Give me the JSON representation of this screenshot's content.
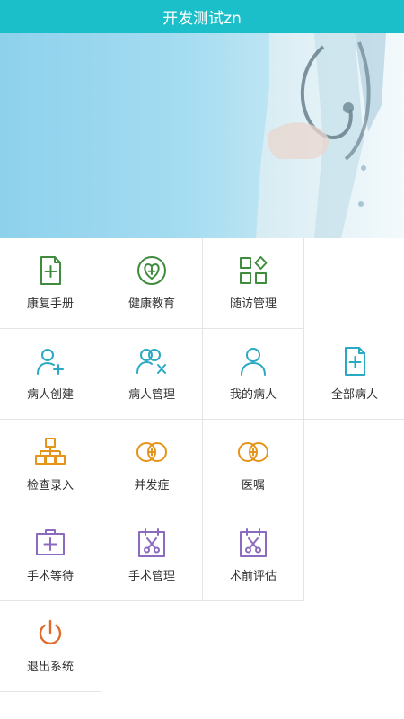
{
  "header": {
    "title": "开发测试zn"
  },
  "banner": {
    "image": "doctor-with-stethoscope"
  },
  "menu": [
    {
      "label": "康复手册",
      "icon": "rehab-manual-icon",
      "color": "#3f8c3e"
    },
    {
      "label": "健康教育",
      "icon": "health-education-icon",
      "color": "#3f8c3e"
    },
    {
      "label": "随访管理",
      "icon": "follow-up-icon",
      "color": "#3f8c3e"
    },
    {
      "label": "病人创建",
      "icon": "add-patient-icon",
      "color": "#2aa9c4"
    },
    {
      "label": "病人管理",
      "icon": "patient-management-icon",
      "color": "#2aa9c4"
    },
    {
      "label": "我的病人",
      "icon": "my-patient-icon",
      "color": "#2aa9c4"
    },
    {
      "label": "全部病人",
      "icon": "all-patients-icon",
      "color": "#2aa9c4"
    },
    {
      "label": "检查录入",
      "icon": "examination-entry-icon",
      "color": "#e5941a"
    },
    {
      "label": "并发症",
      "icon": "complication-icon",
      "color": "#e5941a"
    },
    {
      "label": "医嘱",
      "icon": "medical-order-icon",
      "color": "#e5941a"
    },
    {
      "label": "手术等待",
      "icon": "surgery-waiting-icon",
      "color": "#8b6bbf"
    },
    {
      "label": "手术管理",
      "icon": "surgery-management-icon",
      "color": "#8b6bbf"
    },
    {
      "label": "术前评估",
      "icon": "preoperative-assessment-icon",
      "color": "#8b6bbf"
    },
    {
      "label": "退出系统",
      "icon": "power-icon",
      "color": "#e06a2c"
    }
  ]
}
